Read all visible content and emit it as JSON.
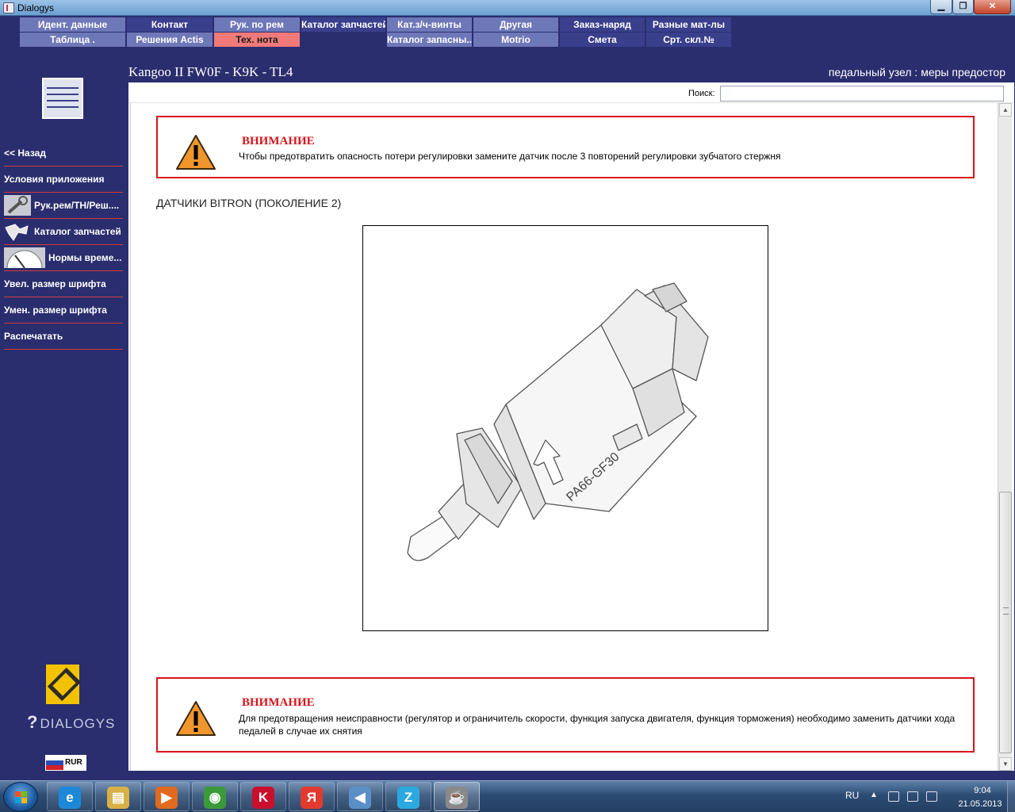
{
  "window": {
    "title": "Dialogys",
    "minimize_glyph": "▁",
    "maximize_glyph": "❐",
    "close_glyph": "✕"
  },
  "top_menu": {
    "row1": [
      "Идент. данные",
      "Контакт",
      "Рук. по рем",
      "Каталог запчастей",
      "Кат.з/ч-винты",
      "Другая",
      "Заказ-наряд",
      "Разные мат-лы"
    ],
    "row2": [
      "Таблица .",
      "Решения Actis",
      "Тех. нота",
      "",
      "Каталог запасны...",
      "Motrio",
      "Смета",
      "Срт. скл.№"
    ],
    "active_item": "Тех. нота"
  },
  "header": {
    "vehicle": "Kangoo II FW0F - K9K - TL4",
    "topic": "педальный узел : меры предостор"
  },
  "sidebar": {
    "items": [
      {
        "label": "<< Назад",
        "icon": null
      },
      {
        "label": "Условия приложения",
        "icon": null
      },
      {
        "label": "Рук.рем/ТН/Реш....",
        "icon": "wrench-icon"
      },
      {
        "label": "Каталог запчастей",
        "icon": "parts-icon"
      },
      {
        "label": "Нормы време...",
        "icon": "speedometer-icon"
      },
      {
        "label": "Увел. размер шрифта",
        "icon": null
      },
      {
        "label": "Умен. размер шрифта",
        "icon": null
      },
      {
        "label": "Распечатать",
        "icon": null
      }
    ],
    "brand": "DIALOGYS",
    "locale_code": "RUR"
  },
  "search": {
    "label": "Поиск:",
    "value": ""
  },
  "document": {
    "warning_1": {
      "title": "ВНИМАНИЕ",
      "text": "Чтобы предотвратить опасность потери регулировки замените датчик после 3 повторений регулировки зубчатого стержня"
    },
    "section_heading": "ДАТЧИКИ BITRON (ПОКОЛЕНИЕ 2)",
    "figure_marking": "PA66-GF30",
    "warning_2": {
      "title": "ВНИМАНИЕ",
      "text": "Для предотвращения неисправности (регулятор и ограничитель скорости, функция запуска двигателя, функция торможения) необходимо заменить датчики хода педалей в случае их снятия"
    }
  },
  "taskbar": {
    "apps": [
      {
        "name": "internet-explorer-icon",
        "glyph": "e",
        "color": "#1e88d8"
      },
      {
        "name": "file-explorer-icon",
        "glyph": "▤",
        "color": "#d8b048"
      },
      {
        "name": "media-player-icon",
        "glyph": "▶",
        "color": "#e06a1e"
      },
      {
        "name": "chrome-icon",
        "glyph": "◉",
        "color": "#3a9a3a"
      },
      {
        "name": "kaspersky-icon",
        "glyph": "K",
        "color": "#c8102e"
      },
      {
        "name": "yandex-icon",
        "glyph": "Я",
        "color": "#e23a2e"
      },
      {
        "name": "speaker-app-icon",
        "glyph": "◀",
        "color": "#5b8fc7"
      },
      {
        "name": "z-app-icon",
        "glyph": "Z",
        "color": "#2ba8e0"
      },
      {
        "name": "java-icon",
        "glyph": "☕",
        "color": "#8a8a8a"
      }
    ],
    "tray": {
      "language": "RU",
      "time": "9:04",
      "date": "21.05.2013"
    }
  },
  "colors": {
    "background": "#2a2e6e",
    "menu_light": "#6e78b8",
    "menu_dark": "#3a3f8c",
    "menu_active": "#f07a7a",
    "warning_red": "#d6151b"
  }
}
